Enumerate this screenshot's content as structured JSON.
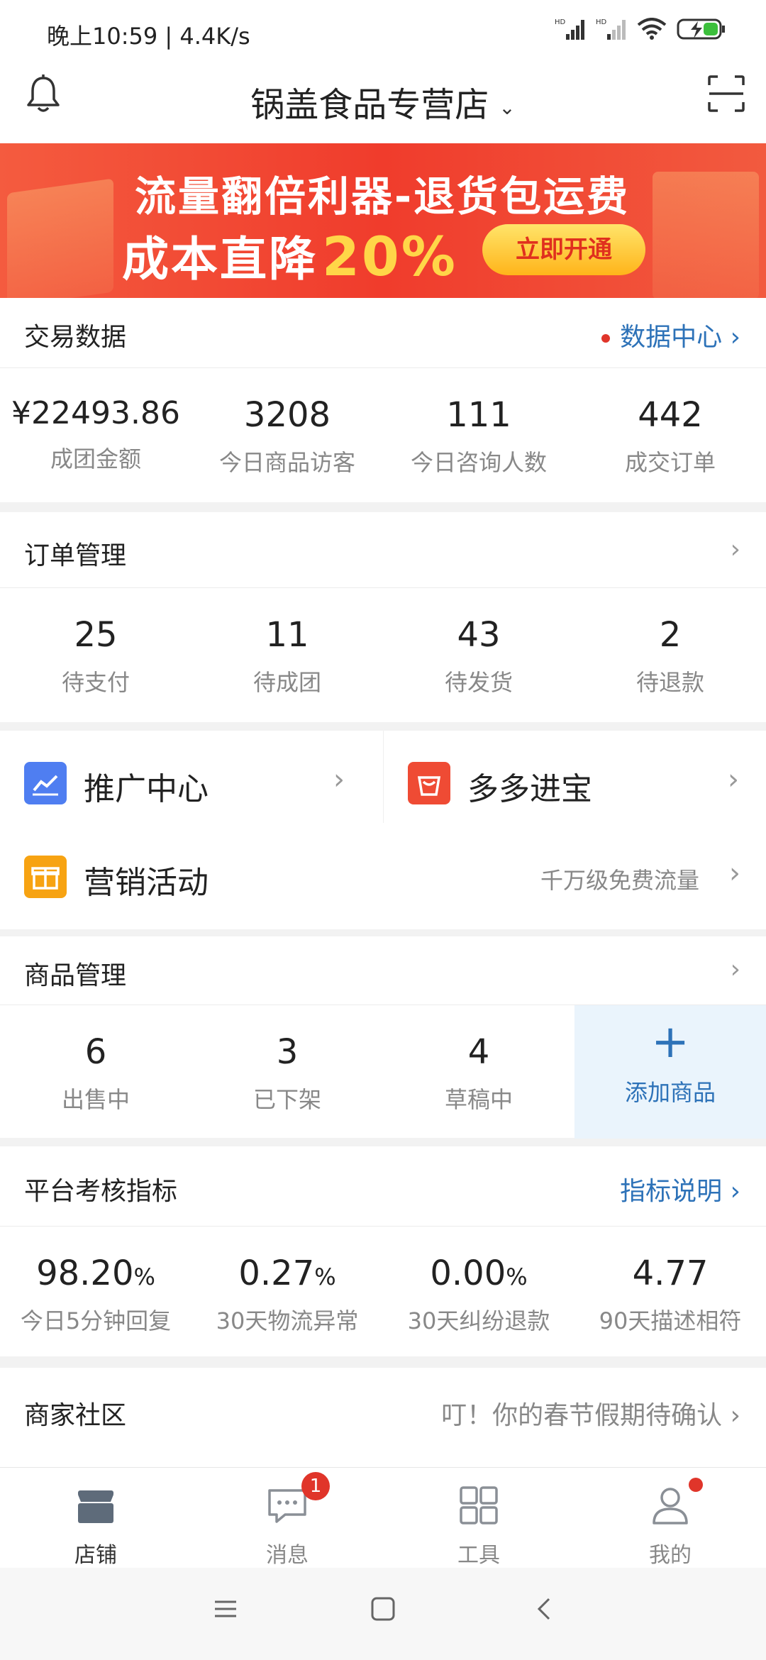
{
  "status": {
    "time": "晚上10:59 | 4.4K/s"
  },
  "header": {
    "store_name": "锅盖食品专营店"
  },
  "banner": {
    "line1": "流量翻倍利器-退货包运费",
    "line2": "成本直降",
    "percent": "20%",
    "button": "立即开通",
    "slides": 4,
    "active_slide": 2
  },
  "trade": {
    "title": "交易数据",
    "link": "数据中心",
    "metrics": [
      {
        "value": "¥22493.86",
        "label": "成团金额"
      },
      {
        "value": "3208",
        "label": "今日商品访客"
      },
      {
        "value": "111",
        "label": "今日咨询人数"
      },
      {
        "value": "442",
        "label": "成交订单"
      }
    ]
  },
  "orders": {
    "title": "订单管理",
    "metrics": [
      {
        "value": "25",
        "label": "待支付"
      },
      {
        "value": "11",
        "label": "待成团"
      },
      {
        "value": "43",
        "label": "待发货"
      },
      {
        "value": "2",
        "label": "待退款"
      }
    ]
  },
  "tools": {
    "promo": "推广中心",
    "duoduo": "多多进宝",
    "marketing": "营销活动",
    "marketing_hint": "千万级免费流量"
  },
  "goods": {
    "title": "商品管理",
    "metrics": [
      {
        "value": "6",
        "label": "出售中"
      },
      {
        "value": "3",
        "label": "已下架"
      },
      {
        "value": "4",
        "label": "草稿中"
      }
    ],
    "add_label": "添加商品",
    "add_icon": "+"
  },
  "platform": {
    "title": "平台考核指标",
    "link": "指标说明",
    "metrics": [
      {
        "value": "98.20",
        "unit": "%",
        "label": "今日5分钟回复"
      },
      {
        "value": "0.27",
        "unit": "%",
        "label": "30天物流异常"
      },
      {
        "value": "0.00",
        "unit": "%",
        "label": "30天纠纷退款"
      },
      {
        "value": "4.77",
        "unit": "",
        "label": "90天描述相符"
      }
    ]
  },
  "community": {
    "title": "商家社区",
    "hint": "叮！你的春节假期待确认"
  },
  "bottom_nav": {
    "items": [
      {
        "label": "店铺"
      },
      {
        "label": "消息",
        "badge": "1"
      },
      {
        "label": "工具"
      },
      {
        "label": "我的"
      }
    ]
  },
  "colors": {
    "accent": "#2d72b8",
    "badge": "#e0352a",
    "banner": "#f03c2c"
  }
}
